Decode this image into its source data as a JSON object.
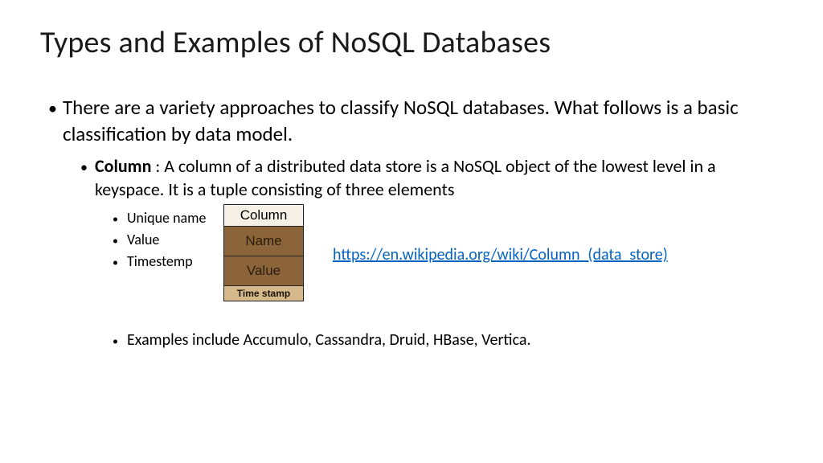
{
  "title": "Types and Examples of NoSQL Databases",
  "bullet_l1": "There are a variety approaches to classify NoSQL databases. What follows is a basic classification by data model.",
  "column_label": "Column",
  "column_desc": " : A column of a distributed data store is a NoSQL object of the lowest level in a keyspace. It is a tuple consisting of three elements",
  "elements": [
    "Unique name",
    "Value",
    "Timestemp"
  ],
  "diagram": {
    "header": "Column",
    "name": "Name",
    "value": "Value",
    "ts": "Time stamp"
  },
  "link_text": "https://en.wikipedia.org/wiki/Column_(data_store)",
  "link_href": "https://en.wikipedia.org/wiki/Column_(data_store)",
  "examples": "Examples include Accumulo, Cassandra, Druid, HBase, Vertica."
}
